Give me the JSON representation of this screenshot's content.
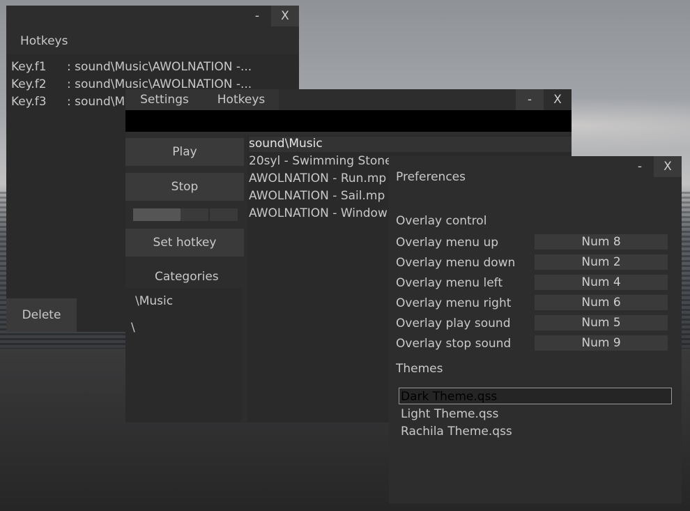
{
  "hotkeys_window": {
    "title": "Hotkeys",
    "minimize": "-",
    "close": "X",
    "rows": [
      {
        "key": "Key.f1",
        "value": ": sound\\Music\\AWOLNATION -..."
      },
      {
        "key": "Key.f2",
        "value": ": sound\\Music\\AWOLNATION -..."
      },
      {
        "key": "Key.f3",
        "value": ": sound\\Music\\AWOLNATION -..."
      }
    ],
    "delete_label": "Delete"
  },
  "main_window": {
    "menu": [
      "Settings",
      "Hotkeys"
    ],
    "minimize": "-",
    "close": "X",
    "play_label": "Play",
    "stop_label": "Stop",
    "progress": 0.45,
    "set_hotkey_label": "Set hotkey",
    "categories_label": "Categories",
    "categories": [
      "\\Music",
      "\\"
    ],
    "files_header": "sound\\Music",
    "files": [
      "20syl - Swimming Stone",
      "AWOLNATION - Run.mp",
      "AWOLNATION - Sail.mp",
      "AWOLNATION - Window"
    ]
  },
  "preferences_window": {
    "title": "Preferences",
    "minimize": "-",
    "close": "X",
    "overlay_heading": "Overlay control",
    "overlay_items": [
      {
        "label": "Overlay menu up",
        "value": "Num 8"
      },
      {
        "label": "Overlay menu down",
        "value": "Num 2"
      },
      {
        "label": "Overlay menu left",
        "value": "Num 4"
      },
      {
        "label": "Overlay menu right",
        "value": "Num 6"
      },
      {
        "label": "Overlay play sound",
        "value": "Num 5"
      },
      {
        "label": "Overlay stop sound",
        "value": "Num 9"
      }
    ],
    "themes_heading": "Themes",
    "themes": [
      "Dark Theme.qss",
      "Light Theme.qss",
      "Rachila Theme.qss"
    ],
    "selected_theme": "Dark Theme.qss"
  },
  "colors": {
    "window_bg": "#2d2d2d",
    "button_bg": "#3a3a3a",
    "text": "#c9c9c9",
    "black_bar": "#000000"
  }
}
